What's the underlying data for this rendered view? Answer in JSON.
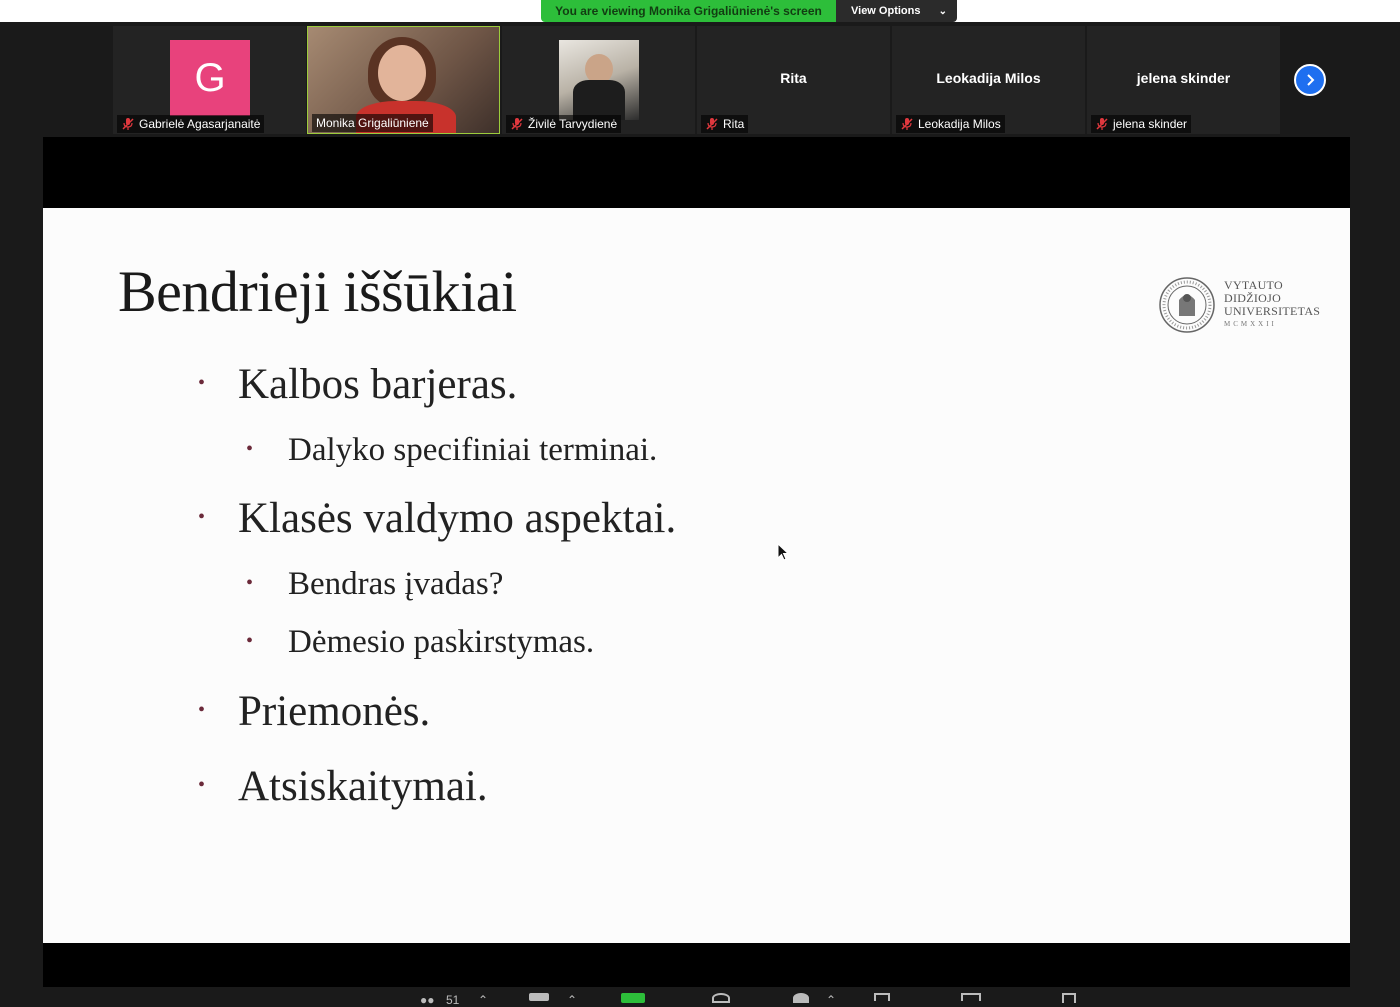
{
  "banner": {
    "viewing_text": "You are viewing Monika Grigaliūnienė's screen",
    "view_options_label": "View Options"
  },
  "participants": [
    {
      "name": "Gabrielė Agasarjanaitė",
      "avatar_letter": "G",
      "muted": true,
      "type": "avatar",
      "avatar_color": "#e8427c"
    },
    {
      "name": "Monika Grigaliūnienė",
      "muted": false,
      "type": "video",
      "active_speaker": true
    },
    {
      "name": "Živilė Tarvydienė",
      "muted": true,
      "type": "video"
    },
    {
      "name": "Rita",
      "center_name": "Rita",
      "muted": true,
      "type": "name"
    },
    {
      "name": "Leokadija Milos",
      "center_name": "Leokadija Milos",
      "muted": true,
      "type": "name"
    },
    {
      "name": "jelena skinder",
      "center_name": "jelena skinder",
      "muted": true,
      "type": "name"
    }
  ],
  "slide": {
    "title": "Bendrieji iššūkiai",
    "logo": {
      "line1": "VYTAUTO",
      "line2": "DIDŽIOJO",
      "line3": "UNIVERSITETAS",
      "roman": "MCMXXII"
    },
    "bullets": [
      {
        "level": 1,
        "text": "Kalbos barjeras."
      },
      {
        "level": 2,
        "text": "Dalyko specifiniai terminai."
      },
      {
        "level": 1,
        "text": "Klasės valdymo aspektai."
      },
      {
        "level": 2,
        "text": "Bendras įvadas?"
      },
      {
        "level": 2,
        "text": "Dėmesio paskirstymas."
      },
      {
        "level": 1,
        "text": "Priemonės."
      },
      {
        "level": 1,
        "text": "Atsiskaitymai."
      }
    ]
  },
  "toolbar": {
    "participants_count": "51"
  },
  "colors": {
    "banner_green": "#2dbe3a",
    "active_speaker_border": "#9ccc3c",
    "next_button": "#1e6ff0",
    "bullet_color": "#6b2a3a",
    "mute_icon": "#e0383e"
  }
}
